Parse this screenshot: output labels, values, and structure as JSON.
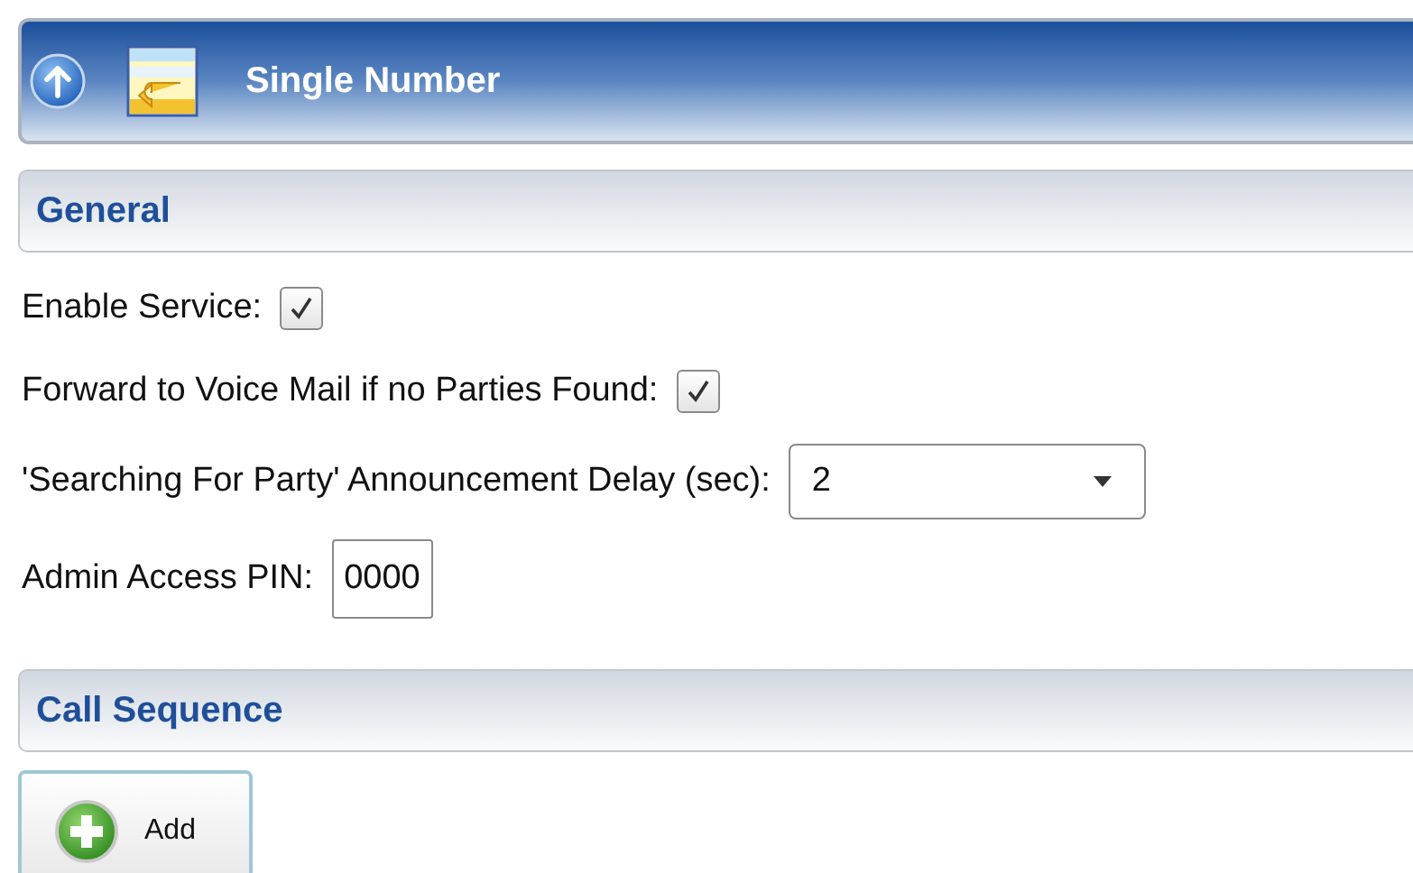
{
  "header": {
    "title": "Single Number"
  },
  "sections": [
    {
      "title": "General",
      "fields": [
        {
          "kind": "checkbox",
          "label": "Enable Service:",
          "checked": true
        },
        {
          "kind": "checkbox",
          "label": "Forward to Voice Mail if no Parties Found:",
          "checked": true
        },
        {
          "kind": "select",
          "label": "'Searching For Party' Announcement Delay (sec):",
          "value": "2"
        },
        {
          "kind": "text",
          "label": "Admin Access PIN:",
          "value": "0000"
        }
      ]
    },
    {
      "title": "Call Sequence",
      "buttons": [
        {
          "label": "Add"
        }
      ]
    }
  ]
}
